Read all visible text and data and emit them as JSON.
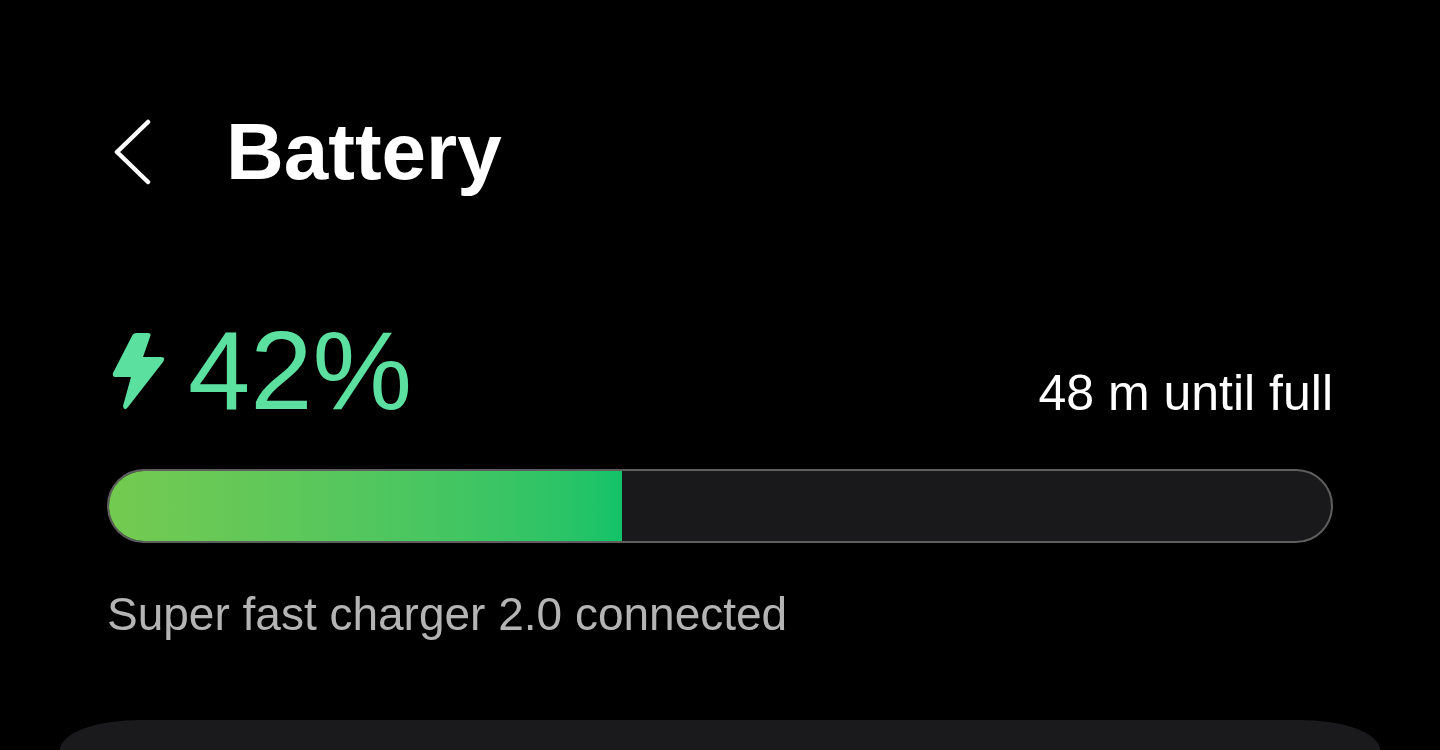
{
  "header": {
    "title": "Battery"
  },
  "battery": {
    "charging": true,
    "percent": "42%",
    "time_remaining": "48 m until full",
    "level": 0.42,
    "charger_status": "Super fast charger 2.0 connected"
  }
}
